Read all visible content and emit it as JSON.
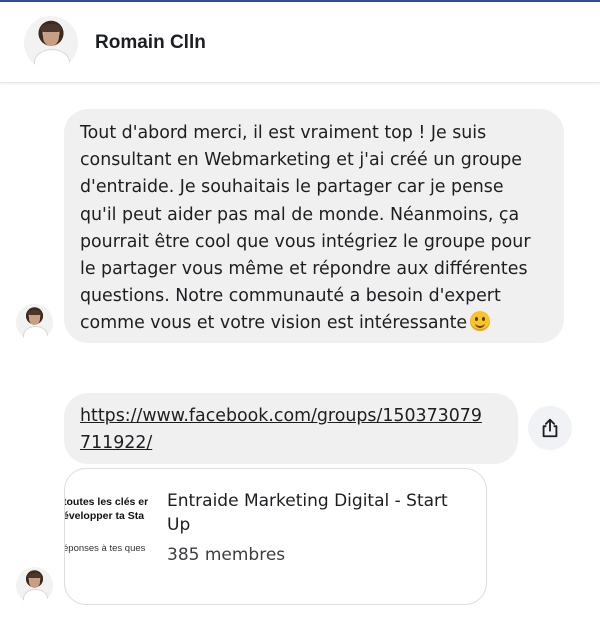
{
  "header": {
    "contact_name": "Romain Clln"
  },
  "messages": [
    {
      "lines": [
        "Tout d'abord merci, il est vraiment top ! Je suis",
        "consultant en Webmarketing et j'ai créé un groupe",
        "d'entraide. Je souhaitais le partager car je pense",
        "qu'il peut aider pas mal de monde. Néanmoins, ça",
        "pourrait être cool que vous intégriez le groupe pour",
        "le partager vous même et répondre aux différentes",
        "questions. Notre communauté a besoin d'expert",
        "comme vous et votre vision est intéressante"
      ],
      "emoji": "slightly-smiling-face"
    },
    {
      "link_lines": [
        "https://www.facebook.com/groups/150373079",
        "711922/"
      ]
    }
  ],
  "link_preview": {
    "thumbnail_lines": [
      "toutes les clés er",
      "évelopper ta Sta",
      "éponses à tes ques"
    ],
    "title": "Entraide Marketing Digital - Start Up",
    "members": "385 membres"
  },
  "icons": {
    "share": "share-icon"
  },
  "colors": {
    "bubble_background": "#f0f0f0",
    "top_border": "#2f4f8f"
  }
}
